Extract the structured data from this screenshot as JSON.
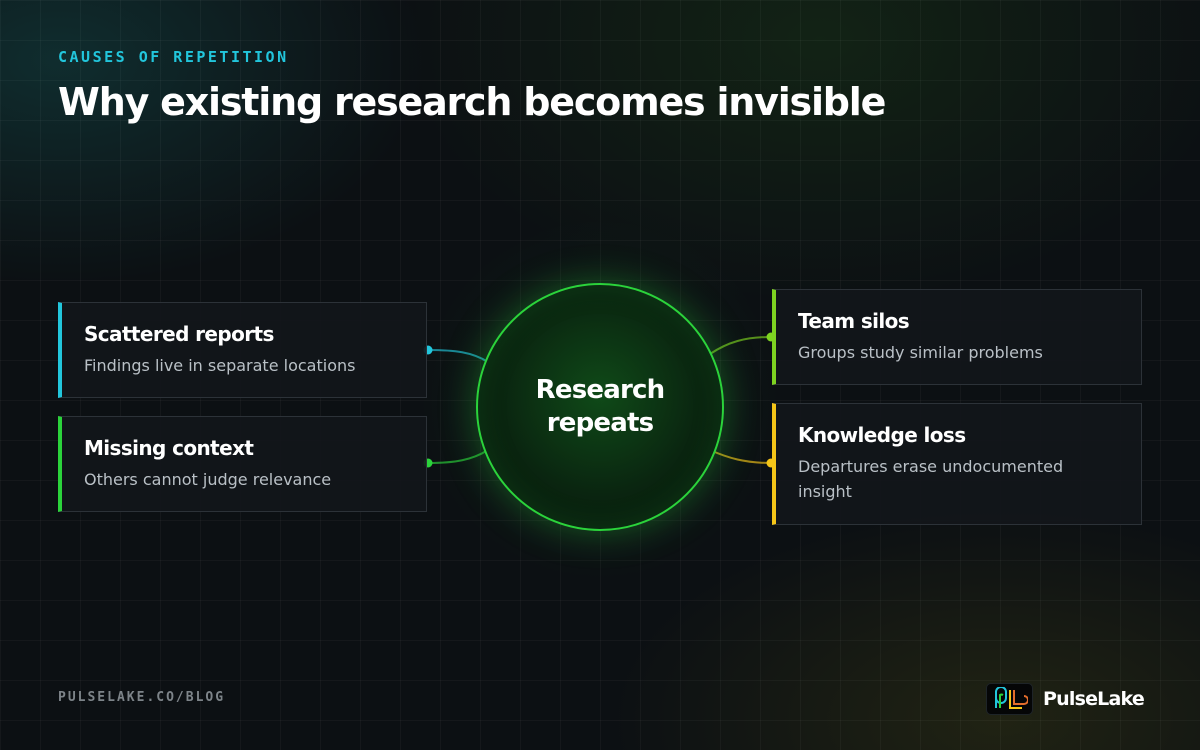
{
  "header": {
    "eyebrow": "CAUSES OF REPETITION",
    "title": "Why existing research becomes invisible"
  },
  "hub": {
    "label": "Research repeats",
    "color": "#2bd33b"
  },
  "causes": [
    {
      "title": "Scattered reports",
      "description": "Findings live in separate locations",
      "accent": "#22c6dc"
    },
    {
      "title": "Missing context",
      "description": "Others cannot judge relevance",
      "accent": "#2bd33b"
    },
    {
      "title": "Team silos",
      "description": "Groups study similar problems",
      "accent": "#7ed321"
    },
    {
      "title": "Knowledge loss",
      "description": "Departures erase undocumented insight",
      "accent": "#f5c518"
    }
  ],
  "footer": {
    "url": "PULSELAKE.CO/BLOG",
    "brand": "PulseLake",
    "logo_icon": "pulselake-logo-icon"
  }
}
